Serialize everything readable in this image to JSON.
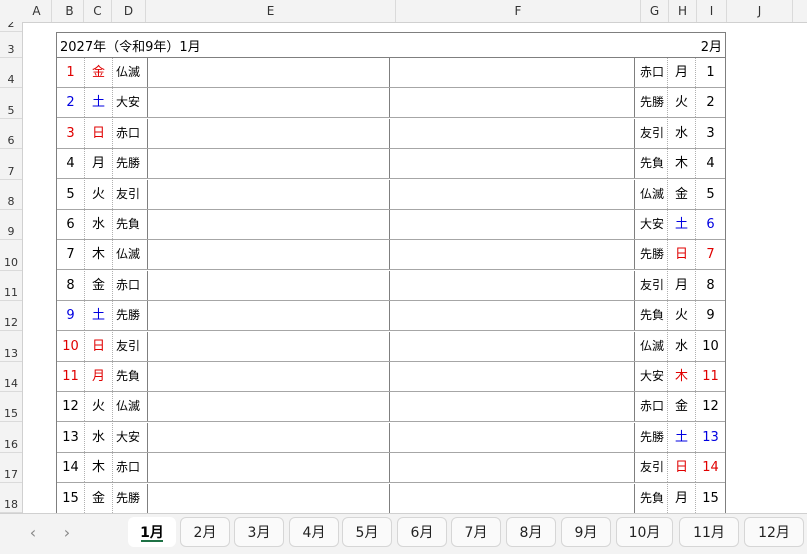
{
  "columns": [
    "A",
    "B",
    "C",
    "D",
    "E",
    "F",
    "G",
    "H",
    "I",
    "J"
  ],
  "rows": [
    "2",
    "3",
    "4",
    "5",
    "6",
    "7",
    "8",
    "9",
    "10",
    "11",
    "12",
    "13",
    "14",
    "15",
    "16",
    "17",
    "18"
  ],
  "title": {
    "left": "2027年（令和9年）1月",
    "right": "2月"
  },
  "left_days": [
    {
      "day": "1",
      "wd": "金",
      "rk": "仏滅",
      "color": "red"
    },
    {
      "day": "2",
      "wd": "土",
      "rk": "大安",
      "color": "blue"
    },
    {
      "day": "3",
      "wd": "日",
      "rk": "赤口",
      "color": "red"
    },
    {
      "day": "4",
      "wd": "月",
      "rk": "先勝",
      "color": ""
    },
    {
      "day": "5",
      "wd": "火",
      "rk": "友引",
      "color": ""
    },
    {
      "day": "6",
      "wd": "水",
      "rk": "先負",
      "color": ""
    },
    {
      "day": "7",
      "wd": "木",
      "rk": "仏滅",
      "color": ""
    },
    {
      "day": "8",
      "wd": "金",
      "rk": "赤口",
      "color": ""
    },
    {
      "day": "9",
      "wd": "土",
      "rk": "先勝",
      "color": "blue"
    },
    {
      "day": "10",
      "wd": "日",
      "rk": "友引",
      "color": "red"
    },
    {
      "day": "11",
      "wd": "月",
      "rk": "先負",
      "color": "red"
    },
    {
      "day": "12",
      "wd": "火",
      "rk": "仏滅",
      "color": ""
    },
    {
      "day": "13",
      "wd": "水",
      "rk": "大安",
      "color": ""
    },
    {
      "day": "14",
      "wd": "木",
      "rk": "赤口",
      "color": ""
    },
    {
      "day": "15",
      "wd": "金",
      "rk": "先勝",
      "color": ""
    }
  ],
  "right_days": [
    {
      "day": "1",
      "wd": "月",
      "rk": "赤口",
      "color": ""
    },
    {
      "day": "2",
      "wd": "火",
      "rk": "先勝",
      "color": ""
    },
    {
      "day": "3",
      "wd": "水",
      "rk": "友引",
      "color": ""
    },
    {
      "day": "4",
      "wd": "木",
      "rk": "先負",
      "color": ""
    },
    {
      "day": "5",
      "wd": "金",
      "rk": "仏滅",
      "color": ""
    },
    {
      "day": "6",
      "wd": "土",
      "rk": "大安",
      "color": "blue"
    },
    {
      "day": "7",
      "wd": "日",
      "rk": "先勝",
      "color": "red"
    },
    {
      "day": "8",
      "wd": "月",
      "rk": "友引",
      "color": ""
    },
    {
      "day": "9",
      "wd": "火",
      "rk": "先負",
      "color": ""
    },
    {
      "day": "10",
      "wd": "水",
      "rk": "仏滅",
      "color": ""
    },
    {
      "day": "11",
      "wd": "木",
      "rk": "大安",
      "color": "red"
    },
    {
      "day": "12",
      "wd": "金",
      "rk": "赤口",
      "color": ""
    },
    {
      "day": "13",
      "wd": "土",
      "rk": "先勝",
      "color": "blue"
    },
    {
      "day": "14",
      "wd": "日",
      "rk": "友引",
      "color": "red"
    },
    {
      "day": "15",
      "wd": "月",
      "rk": "先負",
      "color": ""
    }
  ],
  "tabs": [
    "1月",
    "2月",
    "3月",
    "4月",
    "5月",
    "6月",
    "7月",
    "8月",
    "9月",
    "10月",
    "11月",
    "12月"
  ],
  "active_tab": "1月",
  "nav": {
    "prev_icon": "chevron-left-icon",
    "next_icon": "chevron-right-icon",
    "prev": "‹",
    "next": "›"
  },
  "colors": {
    "holiday": "#e00000",
    "saturday": "#0000e0",
    "tab_accent": "#1e7145"
  }
}
